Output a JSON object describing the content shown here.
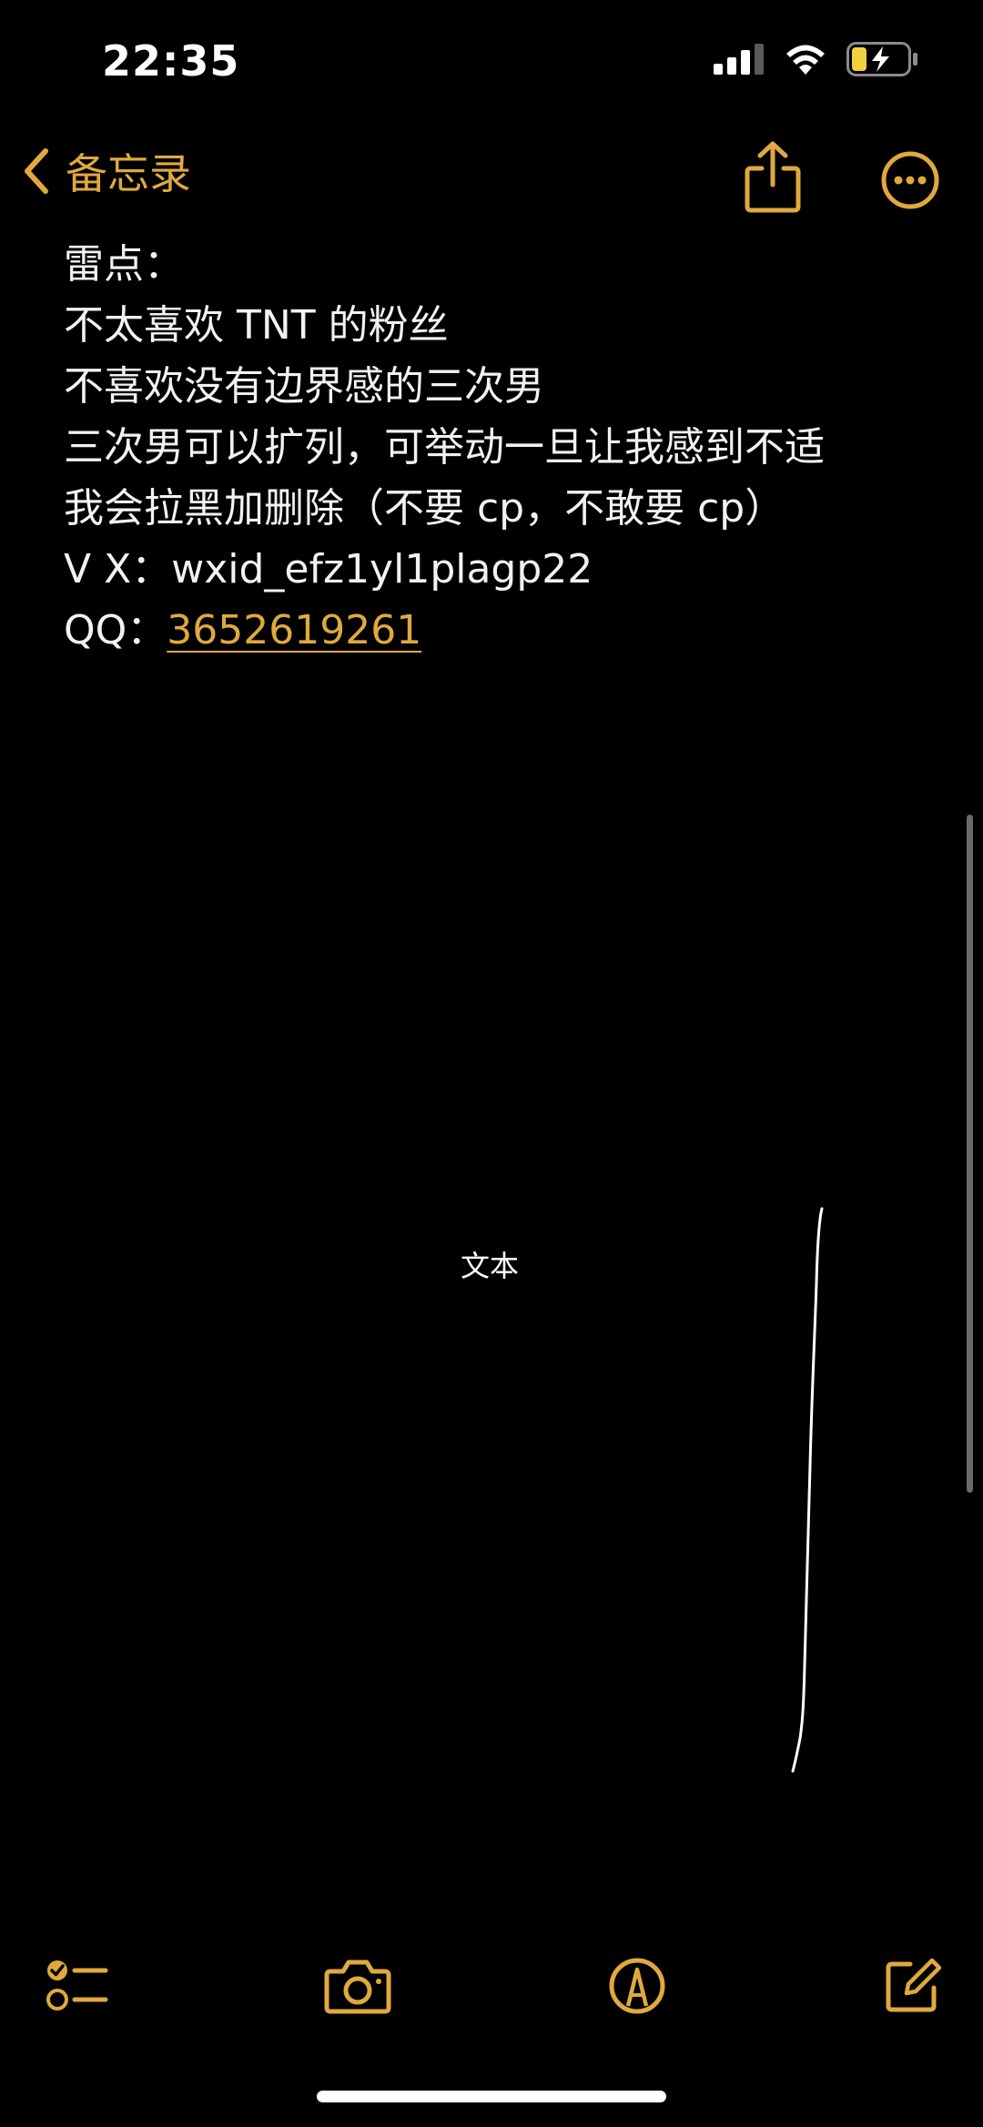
{
  "status_bar": {
    "time": "22:35"
  },
  "nav": {
    "back_label": "备忘录"
  },
  "note": {
    "lines": [
      "雷点：",
      "不太喜欢 TNT 的粉丝",
      "不喜欢没有边界感的三次男",
      "三次男可以扩列，可举动一旦让我感到不适",
      "我会拉黑加删除（不要 cp，不敢要 cp）",
      "V X：wxid_efz1yl1plagp22"
    ],
    "qq_prefix": "QQ：",
    "qq_number": "3652619261"
  },
  "canvas": {
    "text_label": "文本"
  },
  "colors": {
    "accent": "#e0a93e",
    "background": "#000000",
    "text": "#f2f2f2"
  },
  "icons": {
    "back": "chevron-left-icon",
    "share": "share-icon",
    "more": "more-icon",
    "checklist": "checklist-icon",
    "camera": "camera-icon",
    "markup": "markup-pen-icon",
    "compose": "compose-icon"
  }
}
